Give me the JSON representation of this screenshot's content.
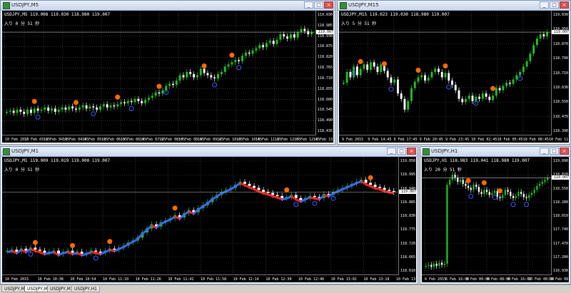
{
  "windows": [
    {
      "id": "w1",
      "title": "USDJPY,M5",
      "info": "USDJPY,M5  119.008 119.030 118.980 119.007",
      "overlay": "入り 0 分 51 秒",
      "price": "119.007",
      "yticks": [
        "119.030",
        "118.985",
        "118.930",
        "118.875",
        "118.820",
        "118.765",
        "118.710",
        "118.655",
        "118.600",
        "118.545",
        "118.490",
        "118.435"
      ],
      "xticks": [
        "10 Feb 2015",
        "10 Feb 03:25",
        "10 Feb 04:05",
        "10 Feb 04:45",
        "10 Feb 05:25",
        "10 Feb 06:05",
        "10 Feb 06:45",
        "10 Feb 07:25",
        "10 Feb 08:05",
        "10 Feb 08:45",
        "10 Feb 09:25",
        "10 Feb 10:05",
        "10 Feb 10:45",
        "10 Feb 11:25",
        "10 Feb 12:05",
        "10 Feb 12:45",
        "10 Feb 13:25"
      ]
    },
    {
      "id": "w2",
      "title": "USDJPY,M15",
      "info": "USDJPY,M15  119.023 119.030 118.980 119.007",
      "overlay": "入り 5 分 51 秒",
      "price": "119.007",
      "yticks": [
        "119.030",
        "118.950",
        "118.870",
        "118.790",
        "118.710",
        "118.630",
        "118.550",
        "118.470",
        "118.390"
      ],
      "xticks": [
        "9 Feb 2015",
        "9 Feb 14:45",
        "9 Feb 17:45",
        "9 Feb 20:45",
        "9 Feb 23:45",
        "10 Feb 02:45",
        "10 Feb 05:45",
        "10 Feb 08:45",
        "10 Feb 11:45"
      ]
    },
    {
      "id": "w3",
      "title": "USDJPY,M1",
      "info": "USDJPY,M1  119.009 119.019 119.000 119.007",
      "overlay": "入り 0 分 51 秒",
      "price": "119.007",
      "yticks": [
        "119.050",
        "118.995",
        "118.940",
        "118.885",
        "118.830",
        "118.775",
        "118.720",
        "118.665",
        "118.610"
      ],
      "xticks": [
        "10 Feb 2015",
        "10 Feb 10:38",
        "10 Feb 10:54",
        "10 Feb 11:10",
        "10 Feb 11:26",
        "10 Feb 11:42",
        "10 Feb 11:58",
        "10 Feb 12:14",
        "10 Feb 12:30",
        "10 Feb 12:46",
        "10 Feb 13:02",
        "10 Feb 13:18",
        "10 Feb 13:34"
      ]
    },
    {
      "id": "w4",
      "title": "USDJPY,H1",
      "info": "USDJPY,H1  118.983 119.041 118.980 119.007",
      "overlay": "入り 20 分 51 秒",
      "price": "119.007",
      "yticks": [
        "119.090",
        "118.820",
        "118.550",
        "118.280",
        "118.010",
        "117.740",
        "117.470",
        "117.200",
        "116.930"
      ],
      "xticks": [
        "6 Feb 2015",
        "6 Feb 16:00",
        "9 Feb 00:00",
        "9 Feb 08:00",
        "9 Feb 16:00",
        "10 Feb 00:00",
        "10 Feb 08:00"
      ]
    }
  ],
  "tabs": [
    {
      "label": "USDJPY,M5",
      "active": false
    },
    {
      "label": "USDJPY,M1",
      "active": true
    },
    {
      "label": "USDJPY,M15",
      "active": false
    },
    {
      "label": "USDJPY,H1",
      "active": false
    }
  ],
  "window_buttons": {
    "minimize": "_",
    "maximize": "□",
    "close": "×"
  },
  "colors": {
    "bull": "#21c321",
    "bear": "#ffffff",
    "ma_down": "#ff2020",
    "ma_up": "#3c64ff",
    "signal_sell": "#ff6a00",
    "signal_buy": "#3c5aff",
    "grid": "#5a5a5a"
  },
  "series": {
    "w1": [
      0.18,
      0.19,
      0.17,
      0.2,
      0.18,
      0.16,
      0.2,
      0.17,
      0.21,
      0.19,
      0.2,
      0.22,
      0.19,
      0.21,
      0.18,
      0.2,
      0.22,
      0.2,
      0.23,
      0.21,
      0.2,
      0.22,
      0.24,
      0.21,
      0.23,
      0.22,
      0.2,
      0.23,
      0.25,
      0.22,
      0.24,
      0.23,
      0.25,
      0.27,
      0.26,
      0.28,
      0.27,
      0.3,
      0.28,
      0.26,
      0.29,
      0.31,
      0.33,
      0.36,
      0.35,
      0.38,
      0.42,
      0.44,
      0.43,
      0.47,
      0.52,
      0.5,
      0.55,
      0.53,
      0.5,
      0.52,
      0.58,
      0.54,
      0.52,
      0.5,
      0.49,
      0.53,
      0.55,
      0.6,
      0.62,
      0.64,
      0.66,
      0.65,
      0.7,
      0.73,
      0.72,
      0.75,
      0.77,
      0.8,
      0.78,
      0.82,
      0.84,
      0.81,
      0.85,
      0.9,
      0.88,
      0.86,
      0.9,
      0.87,
      0.92,
      0.95,
      0.93,
      0.9,
      0.92
    ],
    "w2": [
      0.45,
      0.55,
      0.5,
      0.6,
      0.52,
      0.58,
      0.62,
      0.57,
      0.64,
      0.6,
      0.55,
      0.62,
      0.56,
      0.5,
      0.45,
      0.48,
      0.35,
      0.3,
      0.2,
      0.28,
      0.4,
      0.46,
      0.5,
      0.52,
      0.47,
      0.5,
      0.55,
      0.58,
      0.55,
      0.5,
      0.54,
      0.47,
      0.43,
      0.38,
      0.3,
      0.27,
      0.3,
      0.33,
      0.28,
      0.32,
      0.3,
      0.35,
      0.32,
      0.29,
      0.33,
      0.4,
      0.38,
      0.42,
      0.45,
      0.44,
      0.48,
      0.52,
      0.55,
      0.6,
      0.65,
      0.72,
      0.8,
      0.86,
      0.9,
      0.88,
      0.92
    ],
    "w3": [
      0.2,
      0.21,
      0.19,
      0.22,
      0.2,
      0.23,
      0.21,
      0.2,
      0.18,
      0.19,
      0.2,
      0.17,
      0.19,
      0.2,
      0.18,
      0.19,
      0.17,
      0.18,
      0.2,
      0.19,
      0.18,
      0.2,
      0.22,
      0.21,
      0.23,
      0.25,
      0.28,
      0.3,
      0.33,
      0.38,
      0.42,
      0.46,
      0.44,
      0.48,
      0.5,
      0.52,
      0.55,
      0.53,
      0.57,
      0.6,
      0.58,
      0.62,
      0.65,
      0.68,
      0.72,
      0.75,
      0.78,
      0.8,
      0.82,
      0.85,
      0.88,
      0.86,
      0.84,
      0.82,
      0.8,
      0.78,
      0.77,
      0.75,
      0.74,
      0.72,
      0.73,
      0.75,
      0.72,
      0.7,
      0.72,
      0.74,
      0.73,
      0.72,
      0.76,
      0.75,
      0.78,
      0.8,
      0.82,
      0.84,
      0.86,
      0.88,
      0.9,
      0.87,
      0.85,
      0.83,
      0.82,
      0.8,
      0.79,
      0.78
    ],
    "w4": [
      0.05,
      0.06,
      0.04,
      0.07,
      0.05,
      0.08,
      0.06,
      0.07,
      0.85,
      0.9,
      0.95,
      0.92,
      0.88,
      0.9,
      0.86,
      0.84,
      0.82,
      0.8,
      0.85,
      0.83,
      0.78,
      0.76,
      0.8,
      0.78,
      0.75,
      0.77,
      0.79,
      0.73,
      0.72,
      0.75,
      0.8,
      0.78,
      0.74,
      0.72,
      0.74,
      0.78,
      0.76,
      0.73,
      0.72,
      0.75,
      0.77,
      0.8,
      0.84,
      0.86,
      0.88,
      0.9,
      0.92
    ]
  },
  "signals": {
    "w1": [
      {
        "i": 8,
        "t": "sell"
      },
      {
        "i": 9,
        "t": "buy"
      },
      {
        "i": 20,
        "t": "sell"
      },
      {
        "i": 25,
        "t": "buy"
      },
      {
        "i": 32,
        "t": "sell"
      },
      {
        "i": 36,
        "t": "buy"
      },
      {
        "i": 44,
        "t": "sell"
      },
      {
        "i": 46,
        "t": "buy"
      },
      {
        "i": 57,
        "t": "sell"
      },
      {
        "i": 60,
        "t": "buy"
      },
      {
        "i": 65,
        "t": "sell"
      },
      {
        "i": 67,
        "t": "buy"
      }
    ],
    "w2": [
      {
        "i": 5,
        "t": "sell"
      },
      {
        "i": 3,
        "t": "buy"
      },
      {
        "i": 12,
        "t": "sell"
      },
      {
        "i": 14,
        "t": "buy"
      },
      {
        "i": 22,
        "t": "sell"
      },
      {
        "i": 30,
        "t": "sell"
      },
      {
        "i": 31,
        "t": "buy"
      },
      {
        "i": 39,
        "t": "buy"
      },
      {
        "i": 44,
        "t": "sell"
      },
      {
        "i": 52,
        "t": "buy"
      }
    ],
    "w3": [
      {
        "i": 6,
        "t": "sell"
      },
      {
        "i": 5,
        "t": "buy"
      },
      {
        "i": 14,
        "t": "sell"
      },
      {
        "i": 19,
        "t": "buy"
      },
      {
        "i": 22,
        "t": "sell"
      },
      {
        "i": 36,
        "t": "sell"
      },
      {
        "i": 60,
        "t": "sell"
      },
      {
        "i": 62,
        "t": "buy"
      },
      {
        "i": 66,
        "t": "buy"
      },
      {
        "i": 70,
        "t": "buy"
      },
      {
        "i": 78,
        "t": "sell"
      }
    ],
    "w4": [
      {
        "i": 16,
        "t": "sell"
      },
      {
        "i": 17,
        "t": "buy"
      },
      {
        "i": 22,
        "t": "sell"
      },
      {
        "i": 26,
        "t": "buy"
      },
      {
        "i": 28,
        "t": "sell"
      },
      {
        "i": 33,
        "t": "buy"
      },
      {
        "i": 38,
        "t": "buy"
      }
    ]
  }
}
